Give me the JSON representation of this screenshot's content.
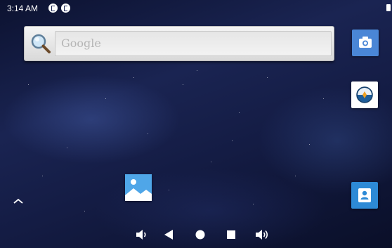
{
  "status_bar": {
    "time": "3:14 AM",
    "left_icons": [
      "notification-icon",
      "notification-icon"
    ],
    "right_icons": [
      "battery-icon"
    ]
  },
  "search_widget": {
    "placeholder": "Google",
    "icon": "magnifier-icon"
  },
  "home_icons": [
    {
      "name": "camera",
      "icon": "camera-icon",
      "color": "#4a86d6"
    },
    {
      "name": "browser",
      "icon": "browser-icon",
      "color": "#ffffff"
    },
    {
      "name": "gallery",
      "icon": "gallery-icon",
      "color": "#4fa6e8"
    },
    {
      "name": "contacts",
      "icon": "contacts-icon",
      "color": "#2d8ad6"
    }
  ],
  "app_drawer_handle": {
    "icon": "chevron-up-icon"
  },
  "navigation_bar": {
    "buttons": [
      "volume-down-icon",
      "back-icon",
      "home-icon",
      "recents-icon",
      "volume-up-icon"
    ]
  }
}
